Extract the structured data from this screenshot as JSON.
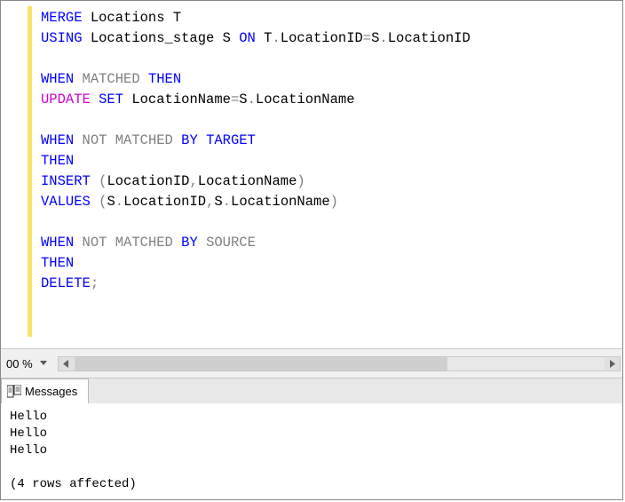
{
  "editor": {
    "zoom_value": "00 %",
    "code": [
      [
        {
          "t": "MERGE",
          "c": "kw-blue"
        },
        {
          "t": " Locations T",
          "c": "txt"
        }
      ],
      [
        {
          "t": "USING",
          "c": "kw-blue"
        },
        {
          "t": " Locations_stage S ",
          "c": "txt"
        },
        {
          "t": "ON",
          "c": "kw-blue"
        },
        {
          "t": " T",
          "c": "txt"
        },
        {
          "t": ".",
          "c": "kw-grey"
        },
        {
          "t": "LocationID",
          "c": "txt"
        },
        {
          "t": "=",
          "c": "kw-grey"
        },
        {
          "t": "S",
          "c": "txt"
        },
        {
          "t": ".",
          "c": "kw-grey"
        },
        {
          "t": "LocationID",
          "c": "txt"
        }
      ],
      [],
      [
        {
          "t": "WHEN",
          "c": "kw-blue"
        },
        {
          "t": " MATCHED ",
          "c": "kw-grey"
        },
        {
          "t": "THEN",
          "c": "kw-blue"
        }
      ],
      [
        {
          "t": "UPDATE",
          "c": "kw-magenta"
        },
        {
          "t": " ",
          "c": "txt"
        },
        {
          "t": "SET",
          "c": "kw-blue"
        },
        {
          "t": " LocationName",
          "c": "txt"
        },
        {
          "t": "=",
          "c": "kw-grey"
        },
        {
          "t": "S",
          "c": "txt"
        },
        {
          "t": ".",
          "c": "kw-grey"
        },
        {
          "t": "LocationName",
          "c": "txt"
        }
      ],
      [],
      [
        {
          "t": "WHEN",
          "c": "kw-blue"
        },
        {
          "t": " ",
          "c": "txt"
        },
        {
          "t": "NOT",
          "c": "kw-grey"
        },
        {
          "t": " MATCHED ",
          "c": "kw-grey"
        },
        {
          "t": "BY",
          "c": "kw-blue"
        },
        {
          "t": " ",
          "c": "txt"
        },
        {
          "t": "TARGET",
          "c": "kw-blue"
        }
      ],
      [
        {
          "t": "THEN",
          "c": "kw-blue"
        }
      ],
      [
        {
          "t": "INSERT",
          "c": "kw-blue"
        },
        {
          "t": " ",
          "c": "txt"
        },
        {
          "t": "(",
          "c": "kw-grey"
        },
        {
          "t": "LocationID",
          "c": "txt"
        },
        {
          "t": ",",
          "c": "kw-grey"
        },
        {
          "t": "LocationName",
          "c": "txt"
        },
        {
          "t": ")",
          "c": "kw-grey"
        }
      ],
      [
        {
          "t": "VALUES",
          "c": "kw-blue"
        },
        {
          "t": " ",
          "c": "txt"
        },
        {
          "t": "(",
          "c": "kw-grey"
        },
        {
          "t": "S",
          "c": "txt"
        },
        {
          "t": ".",
          "c": "kw-grey"
        },
        {
          "t": "LocationID",
          "c": "txt"
        },
        {
          "t": ",",
          "c": "kw-grey"
        },
        {
          "t": "S",
          "c": "txt"
        },
        {
          "t": ".",
          "c": "kw-grey"
        },
        {
          "t": "LocationName",
          "c": "txt"
        },
        {
          "t": ")",
          "c": "kw-grey"
        }
      ],
      [],
      [
        {
          "t": "WHEN",
          "c": "kw-blue"
        },
        {
          "t": " ",
          "c": "txt"
        },
        {
          "t": "NOT",
          "c": "kw-grey"
        },
        {
          "t": " MATCHED ",
          "c": "kw-grey"
        },
        {
          "t": "BY",
          "c": "kw-blue"
        },
        {
          "t": " SOURCE",
          "c": "kw-grey"
        }
      ],
      [
        {
          "t": "THEN",
          "c": "kw-blue"
        }
      ],
      [
        {
          "t": "DELETE",
          "c": "kw-blue"
        },
        {
          "t": ";",
          "c": "kw-grey"
        }
      ]
    ]
  },
  "tabs": {
    "messages_label": "Messages"
  },
  "messages": {
    "line1": "Hello",
    "line2": "Hello",
    "line3": "Hello",
    "blank": "",
    "line4": "(4 rows affected)"
  }
}
